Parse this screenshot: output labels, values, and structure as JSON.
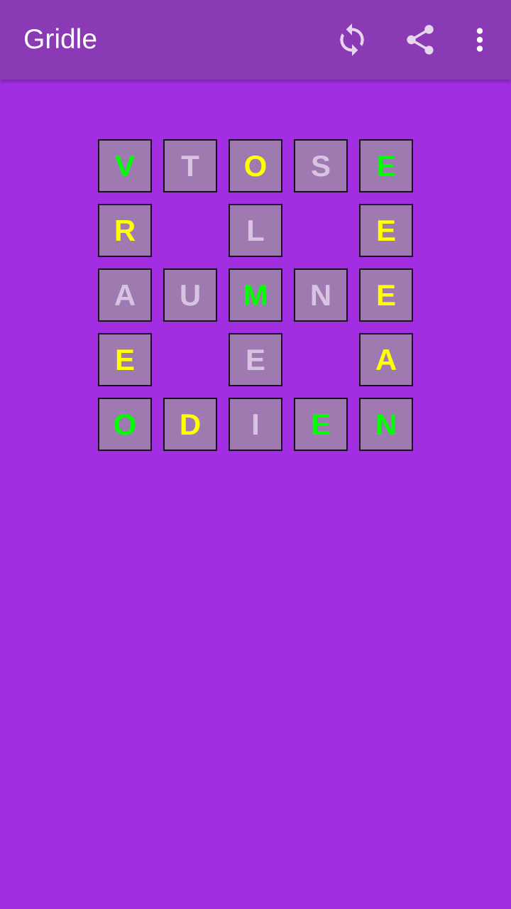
{
  "appbar": {
    "title": "Gridle",
    "icons": [
      "refresh-icon",
      "share-icon",
      "more-vert-icon"
    ]
  },
  "colors": {
    "correct": "#00ff00",
    "present": "#ffff00",
    "absent": "#d8c3e2"
  },
  "grid": [
    [
      {
        "letter": "V",
        "state": "correct"
      },
      {
        "letter": "T",
        "state": "absent"
      },
      {
        "letter": "O",
        "state": "present"
      },
      {
        "letter": "S",
        "state": "absent"
      },
      {
        "letter": "E",
        "state": "correct"
      }
    ],
    [
      {
        "letter": "R",
        "state": "present"
      },
      null,
      {
        "letter": "L",
        "state": "absent"
      },
      null,
      {
        "letter": "E",
        "state": "present"
      }
    ],
    [
      {
        "letter": "A",
        "state": "absent"
      },
      {
        "letter": "U",
        "state": "absent"
      },
      {
        "letter": "M",
        "state": "correct"
      },
      {
        "letter": "N",
        "state": "absent"
      },
      {
        "letter": "E",
        "state": "present"
      }
    ],
    [
      {
        "letter": "E",
        "state": "present"
      },
      null,
      {
        "letter": "E",
        "state": "absent"
      },
      null,
      {
        "letter": "A",
        "state": "present"
      }
    ],
    [
      {
        "letter": "O",
        "state": "correct"
      },
      {
        "letter": "D",
        "state": "present"
      },
      {
        "letter": "I",
        "state": "absent"
      },
      {
        "letter": "E",
        "state": "correct"
      },
      {
        "letter": "N",
        "state": "correct"
      }
    ]
  ]
}
